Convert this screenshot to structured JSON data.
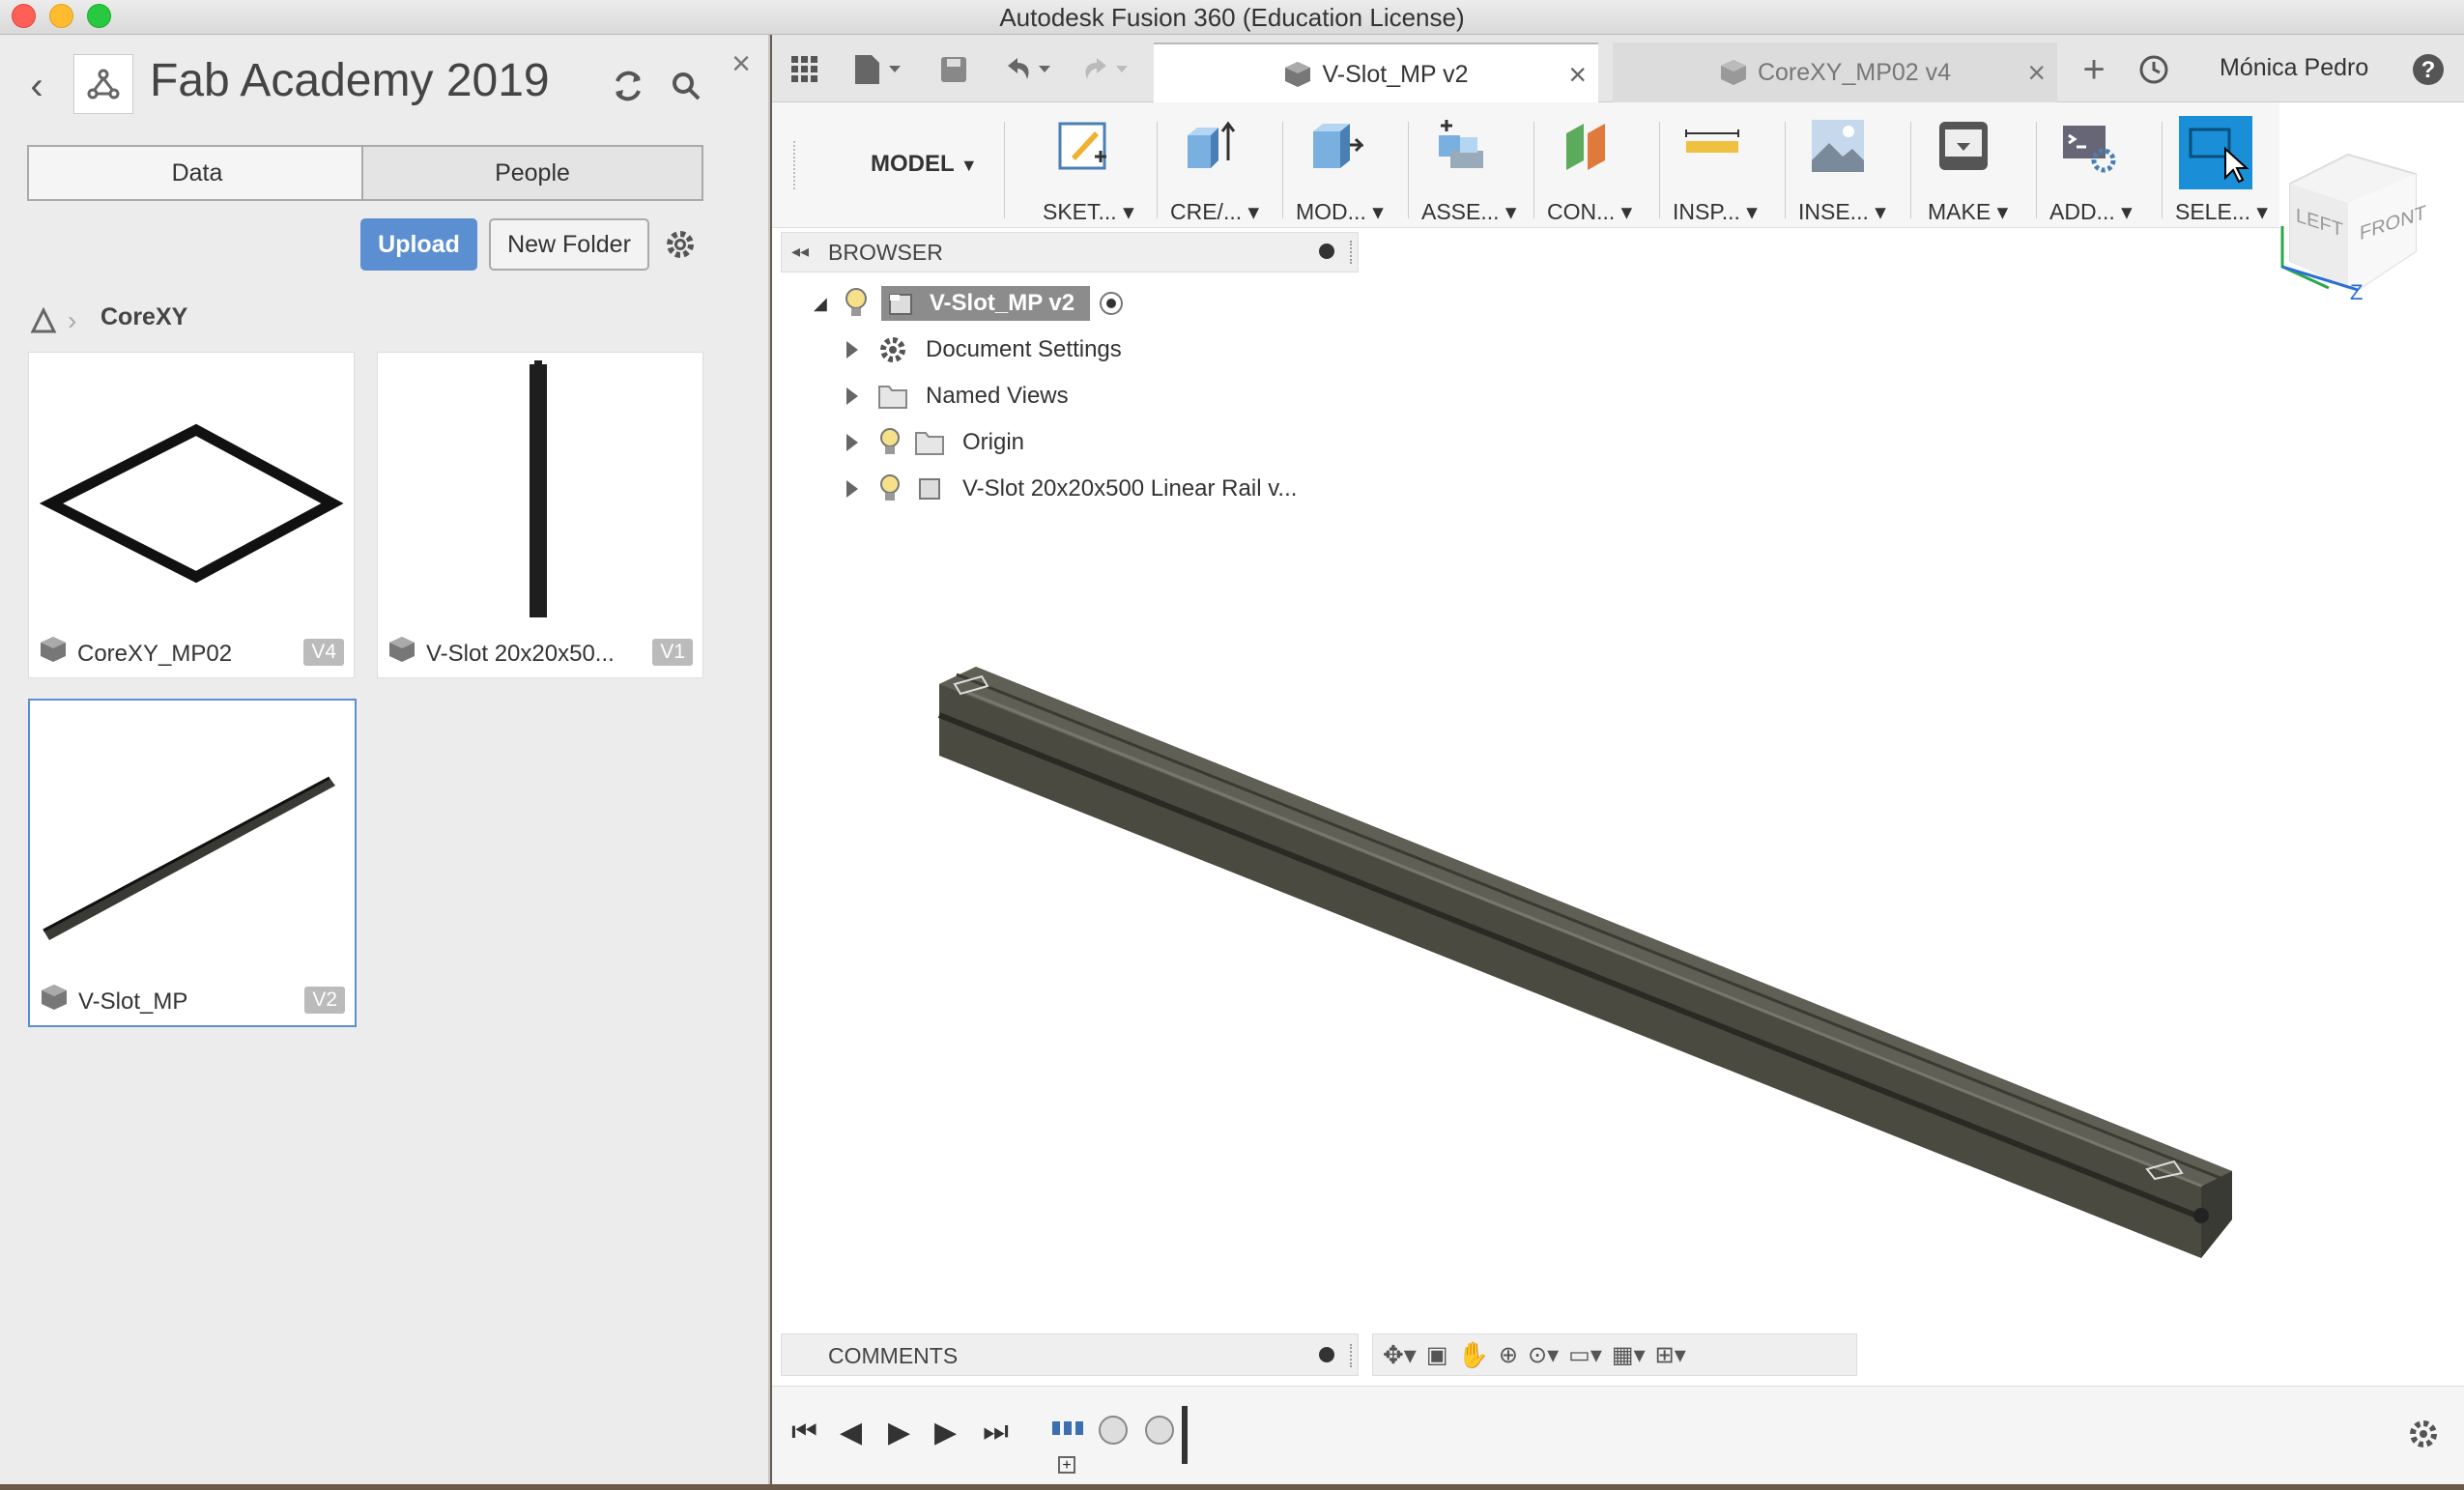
{
  "window": {
    "title": "Autodesk Fusion 360 (Education License)"
  },
  "data_panel": {
    "project_title": "Fab Academy 2019",
    "tabs": [
      "Data",
      "People"
    ],
    "upload_label": "Upload",
    "new_folder_label": "New Folder",
    "breadcrumb": "CoreXY",
    "files": [
      {
        "name": "CoreXY_MP02",
        "version": "V4"
      },
      {
        "name": "V-Slot 20x20x50...",
        "version": "V1"
      },
      {
        "name": "V-Slot_MP",
        "version": "V2"
      }
    ]
  },
  "document_tabs": [
    {
      "label": "V-Slot_MP v2",
      "active": true
    },
    {
      "label": "CoreXY_MP02 v4",
      "active": false
    }
  ],
  "user_name": "Mónica Pedro",
  "workspace": "MODEL",
  "toolbar": [
    "SKET...",
    "CRE/...",
    "MOD...",
    "ASSE...",
    "CON...",
    "INSP...",
    "INSE...",
    "MAKE",
    "ADD...",
    "SELE..."
  ],
  "browser": {
    "header": "BROWSER",
    "root": "V-Slot_MP v2",
    "items": [
      "Document Settings",
      "Named Views",
      "Origin",
      "V-Slot 20x20x500 Linear Rail v..."
    ]
  },
  "viewcube": {
    "left": "LEFT",
    "front": "FRONT",
    "axis": "Z"
  },
  "comments_label": "COMMENTS",
  "colors": {
    "accent": "#5b8fd2",
    "select_blue": "#1a8ed6"
  }
}
